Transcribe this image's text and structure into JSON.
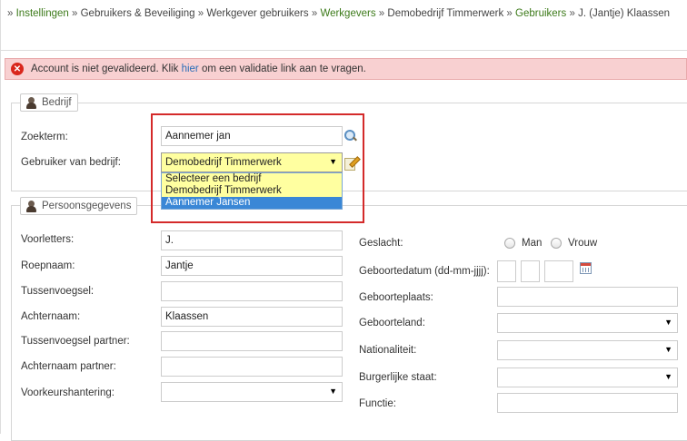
{
  "breadcrumb": {
    "items": [
      {
        "label": "Instellingen",
        "link": true
      },
      {
        "label": "Gebruikers & Beveiliging",
        "link": false
      },
      {
        "label": "Werkgever gebruikers",
        "link": false
      },
      {
        "label": "Werkgevers",
        "link": true
      },
      {
        "label": "Demobedrijf Timmerwerk",
        "link": false
      },
      {
        "label": "Gebruikers",
        "link": true
      },
      {
        "label": "J. (Jantje) Klaassen",
        "link": false
      }
    ],
    "separator": "»"
  },
  "alert": {
    "text_before": "Account is niet gevalideerd. Klik ",
    "link_text": "hier",
    "text_after": " om een validatie link aan te vragen."
  },
  "bedrijf": {
    "legend": "Bedrijf",
    "search_label": "Zoekterm:",
    "search_value": "Aannemer jan",
    "company_label": "Gebruiker van bedrijf:",
    "company_selected": "Demobedrijf Timmerwerk",
    "options": [
      "Selecteer een bedrijf",
      "Demobedrijf Timmerwerk",
      "Aannemer Jansen"
    ],
    "highlighted_option": "Aannemer Jansen"
  },
  "persoon": {
    "legend": "Persoonsgegevens",
    "left": [
      {
        "label": "Voorletters:",
        "value": "J.",
        "type": "text"
      },
      {
        "label": "Roepnaam:",
        "value": "Jantje",
        "type": "text"
      },
      {
        "label": "Tussenvoegsel:",
        "value": "",
        "type": "text"
      },
      {
        "label": "Achternaam:",
        "value": "Klaassen",
        "type": "text"
      },
      {
        "label": "Tussenvoegsel partner:",
        "value": "",
        "type": "text"
      },
      {
        "label": "Achternaam partner:",
        "value": "",
        "type": "text"
      },
      {
        "label": "Voorkeurshantering:",
        "value": "",
        "type": "select"
      }
    ],
    "gender_label": "Geslacht:",
    "gender_options": [
      "Man",
      "Vrouw"
    ],
    "birthdate_label": "Geboortedatum (dd-mm-jjjj):",
    "birthplace_label": "Geboorteplaats:",
    "birthcountry_label": "Geboorteland:",
    "nationality_label": "Nationaliteit:",
    "marital_label": "Burgerlijke staat:",
    "function_label": "Functie:"
  },
  "colors": {
    "link_green": "#3c7a19",
    "alert_bg": "#f8d0d1",
    "error_red": "#d9261c",
    "highlight_box": "#d42a2a",
    "option_selected": "#3a87d6"
  }
}
